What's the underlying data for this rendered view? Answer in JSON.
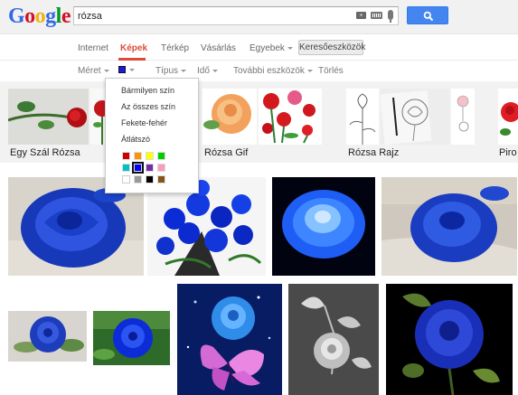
{
  "header": {
    "logo_letters": [
      {
        "char": "G",
        "color": "#3369e8"
      },
      {
        "char": "o",
        "color": "#d50f25"
      },
      {
        "char": "o",
        "color": "#eeb211"
      },
      {
        "char": "g",
        "color": "#3369e8"
      },
      {
        "char": "l",
        "color": "#009925"
      },
      {
        "char": "e",
        "color": "#d50f25"
      }
    ],
    "query": "rózsa",
    "icons": [
      "camera-icon",
      "keyboard-icon",
      "microphone-icon",
      "search-icon"
    ]
  },
  "nav": {
    "tabs": [
      {
        "label": "Internet",
        "active": false
      },
      {
        "label": "Képek",
        "active": true
      },
      {
        "label": "Térkép",
        "active": false
      },
      {
        "label": "Vásárlás",
        "active": false
      },
      {
        "label": "Egyebek",
        "active": false
      }
    ],
    "tools_button": "Keresőeszközök"
  },
  "tools": {
    "size": "Méret",
    "type": "Típus",
    "time": "Idő",
    "more": "További eszközök",
    "clear": "Törlés",
    "selected_color": "#1a1ae8"
  },
  "color_menu": {
    "items": [
      "Bármilyen szín",
      "Az összes szín",
      "Fekete-fehér",
      "Átlátszó"
    ],
    "palette_row1": [
      "#cc0000",
      "#fb940b",
      "#ffff00",
      "#00cc00"
    ],
    "palette_row2": [
      "#03c0c6",
      "#0000ff",
      "#762ca7",
      "#ff98bf"
    ],
    "palette_row3": [
      "#ffffff",
      "#999999",
      "#000000",
      "#885418"
    ],
    "selected_color": "#0000ff"
  },
  "related": [
    {
      "label": "Egy Szál Rózsa"
    },
    {
      "label": "Rózsa Gif"
    },
    {
      "label": "Rózsa Rajz"
    },
    {
      "label": "Piro"
    }
  ]
}
